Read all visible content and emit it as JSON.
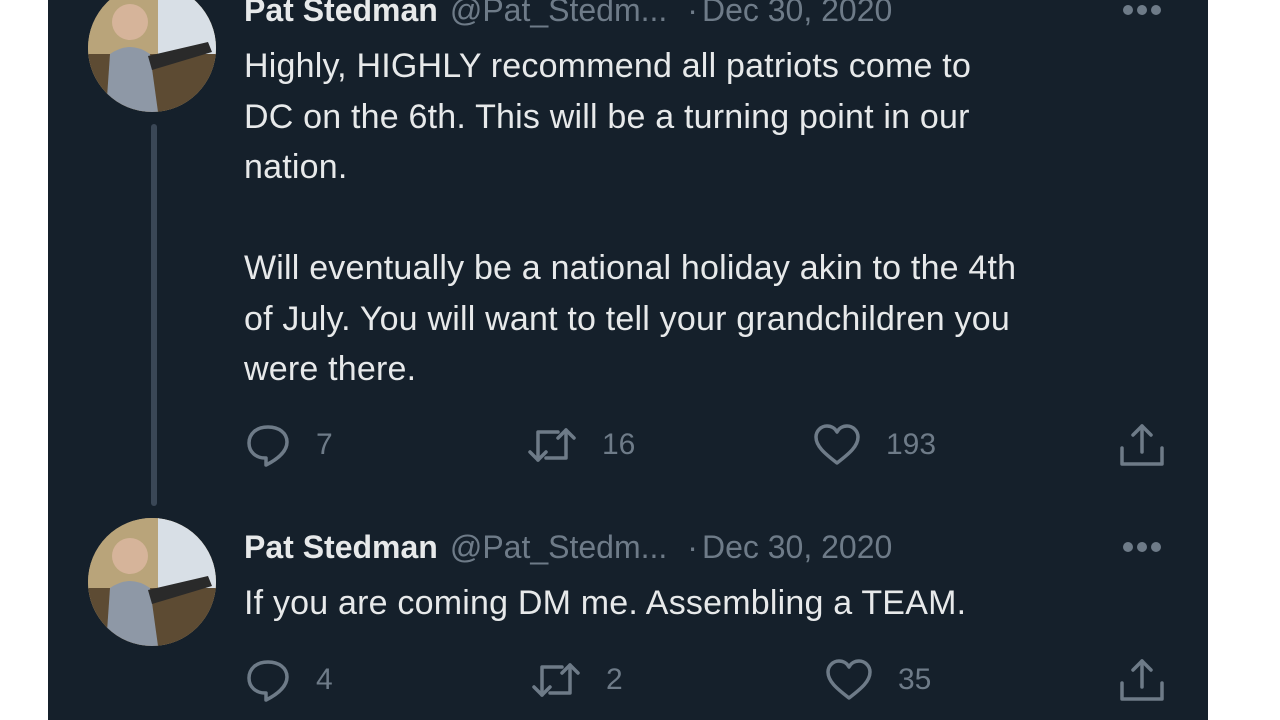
{
  "tweets": [
    {
      "name": "Pat Stedman",
      "handle": "@Pat_Stedm...",
      "separator": "·",
      "date": "Dec 30, 2020",
      "text": "Highly, HIGHLY recommend all patriots come to\nDC on the 6th. This will be a turning point in our\nnation.\n\nWill eventually be a national holiday akin to the 4th\nof July. You will want to tell your grandchildren you\nwere there.",
      "replies": "7",
      "retweets": "16",
      "likes": "193"
    },
    {
      "name": "Pat Stedman",
      "handle": "@Pat_Stedm...",
      "separator": "·",
      "date": "Dec 30, 2020",
      "text": "If you are coming DM me. Assembling a TEAM.",
      "replies": "4",
      "retweets": "2",
      "likes": "35"
    }
  ],
  "icons": {
    "reply": "reply-icon",
    "retweet": "retweet-icon",
    "like": "heart-icon",
    "share": "share-icon",
    "more": "more-icon"
  },
  "colors": {
    "background": "#15202b",
    "text_primary": "#e7e9ea",
    "text_secondary": "#6e7b88",
    "thread_line": "#3a4756"
  }
}
